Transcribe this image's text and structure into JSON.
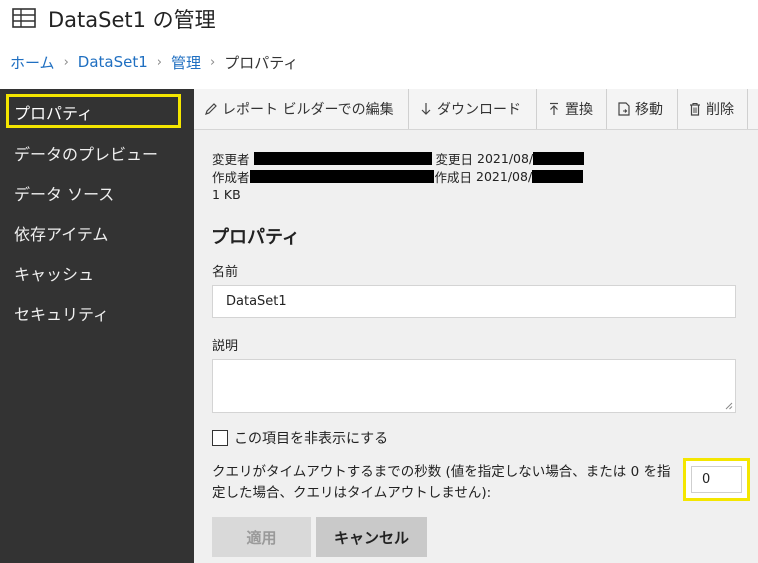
{
  "header": {
    "title": "DataSet1 の管理"
  },
  "breadcrumb": {
    "home": "ホーム",
    "dataset": "DataSet1",
    "manage": "管理",
    "current": "プロパティ"
  },
  "sidebar": {
    "items": [
      {
        "label": "プロパティ",
        "active": true
      },
      {
        "label": "データのプレビュー"
      },
      {
        "label": "データ ソース"
      },
      {
        "label": "依存アイテム"
      },
      {
        "label": "キャッシュ"
      },
      {
        "label": "セキュリティ"
      }
    ]
  },
  "toolbar": {
    "edit_label": "レポート ビルダーでの編集",
    "download_label": "ダウンロード",
    "replace_label": "置換",
    "move_label": "移動",
    "delete_label": "削除"
  },
  "meta": {
    "modified_by_label": "変更者",
    "modified_date_label": "変更日",
    "modified_date_value": "2021/08/",
    "created_by_label": "作成者",
    "created_date_label": "作成日",
    "created_date_value": "2021/08/",
    "size": "1 KB"
  },
  "form": {
    "section_title": "プロパティ",
    "name_label": "名前",
    "name_value": "DataSet1",
    "description_label": "説明",
    "description_value": "",
    "hide_label": "この項目を非表示にする",
    "hide_checked": false,
    "timeout_label": "クエリがタイムアウトするまでの秒数 (値を指定しない場合、または 0 を指定した場合、クエリはタイムアウトしません):",
    "timeout_value": "0",
    "apply_label": "適用",
    "cancel_label": "キャンセル"
  },
  "colors": {
    "sidebar_bg": "#333333",
    "highlight": "#f4e600",
    "link": "#1f6fc1"
  }
}
